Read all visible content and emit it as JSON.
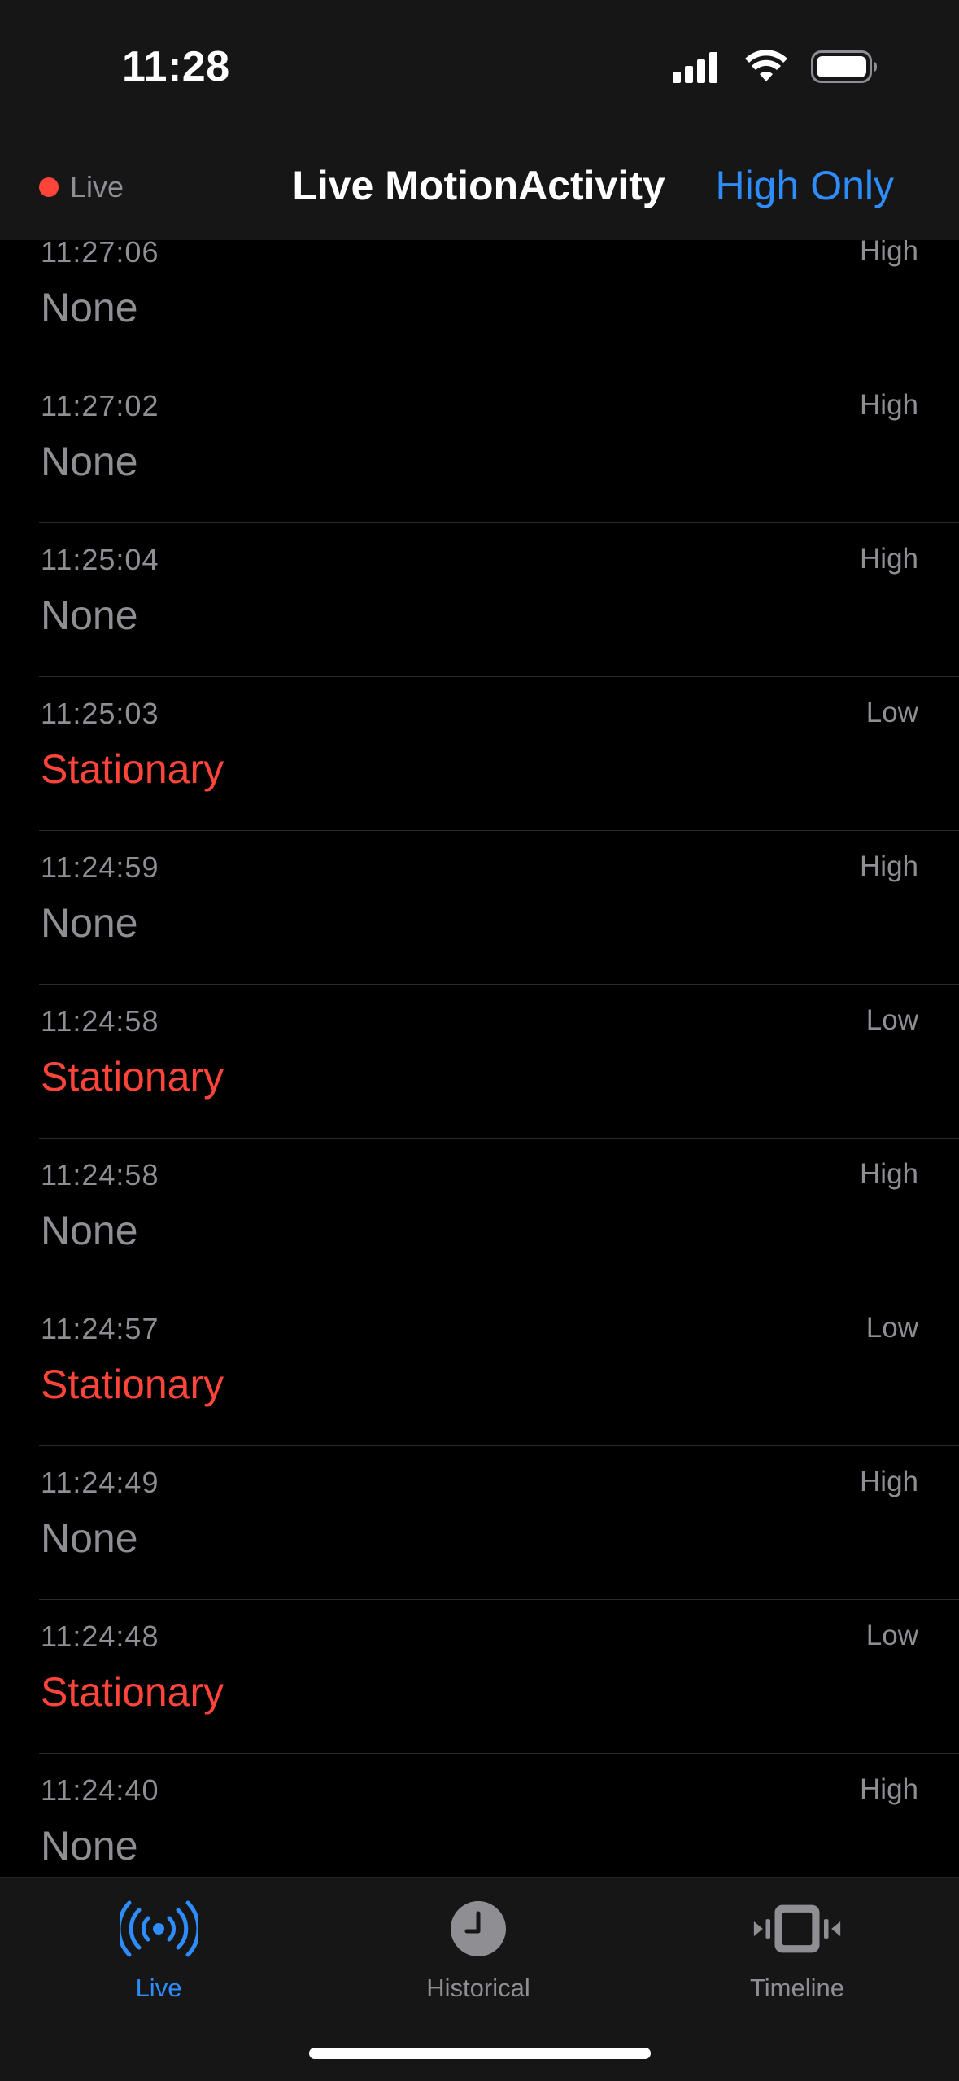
{
  "status_bar": {
    "time": "11:28",
    "icons": [
      "cellular-signal-icon",
      "wifi-icon",
      "battery-icon"
    ]
  },
  "header": {
    "live_label": "Live",
    "title": "Live MotionActivity",
    "filter_button": "High Only"
  },
  "colors": {
    "accent": "#2f8dfb",
    "live_dot": "#ff453a",
    "stationary": "#ff453a",
    "secondary_text": "#8e8e93"
  },
  "entries": [
    {
      "time": "11:27:06",
      "confidence": "High",
      "activity": "None"
    },
    {
      "time": "11:27:02",
      "confidence": "High",
      "activity": "None"
    },
    {
      "time": "11:25:04",
      "confidence": "High",
      "activity": "None"
    },
    {
      "time": "11:25:03",
      "confidence": "Low",
      "activity": "Stationary"
    },
    {
      "time": "11:24:59",
      "confidence": "High",
      "activity": "None"
    },
    {
      "time": "11:24:58",
      "confidence": "Low",
      "activity": "Stationary"
    },
    {
      "time": "11:24:58",
      "confidence": "High",
      "activity": "None"
    },
    {
      "time": "11:24:57",
      "confidence": "Low",
      "activity": "Stationary"
    },
    {
      "time": "11:24:49",
      "confidence": "High",
      "activity": "None"
    },
    {
      "time": "11:24:48",
      "confidence": "Low",
      "activity": "Stationary"
    },
    {
      "time": "11:24:40",
      "confidence": "High",
      "activity": "None"
    }
  ],
  "tabs": [
    {
      "label": "Live",
      "icon": "broadcast-icon",
      "active": true
    },
    {
      "label": "Historical",
      "icon": "clock-icon",
      "active": false
    },
    {
      "label": "Timeline",
      "icon": "phone-vibrate-icon",
      "active": false
    }
  ]
}
